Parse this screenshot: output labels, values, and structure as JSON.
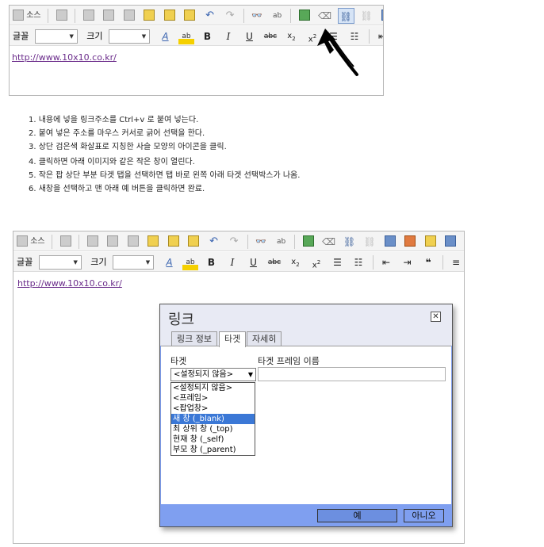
{
  "colors": {
    "link": "#6a2b8a",
    "dialog_bg": "#7f9ff0",
    "dropdown_active": "#3b78d6"
  },
  "editor1": {
    "toolbar": {
      "source_label": "소스",
      "font_label": "글꼴",
      "size_label": "크기"
    },
    "content_link": "http://www.10x10.co.kr/"
  },
  "instructions": [
    "1. 내용에 넣을 링크주소를 Ctrl+v 로 붙여 넣는다.",
    "2. 붙여 넣은 주소를 마우스 커서로 긁어 선택을 한다.",
    "3. 상단 검은색 화살표로 지칭한 사슬 모양의 아이콘을 클릭.",
    "4. 클릭하면 아래 이미지와 같은 작은 창이 열린다.",
    "5. 작은 팝 상단 부분 타겟 탭을 선택하면 탭 바로 왼쪽 아래 타겟 선택박스가 나옴.",
    "6. 새창을 선택하고 맨 아래 예 버튼을 클릭하면 완료."
  ],
  "editor2": {
    "toolbar": {
      "source_label": "소스",
      "font_label": "글꼴",
      "size_label": "크기"
    },
    "content_link": "http://www.10x10.co.kr/"
  },
  "dialog": {
    "title": "링크",
    "close_glyph": "✕",
    "tabs": [
      "링크 정보",
      "타겟",
      "자세히"
    ],
    "active_tab": "타겟",
    "target_label": "타겟",
    "frame_name_label": "타겟 프레임 이름",
    "target_selected": "<설정되지 않음>",
    "target_options": [
      "<설정되지 않음>",
      "<프레임>",
      "<팝업창>",
      "새 창 (_blank)",
      "최 상위 창 (_top)",
      "현재 창 (_self)",
      "부모 창 (_parent)"
    ],
    "highlighted_option": "새 창 (_blank)",
    "ok_label": "예",
    "cancel_label": "아니오"
  }
}
